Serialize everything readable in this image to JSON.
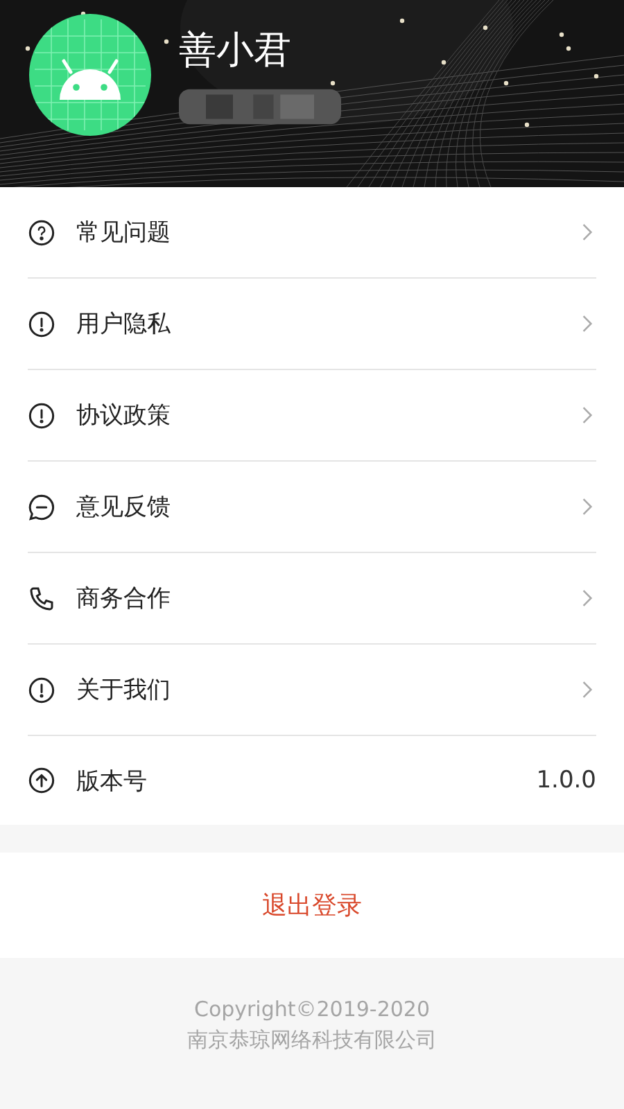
{
  "profile": {
    "name": "善小君"
  },
  "menu": [
    {
      "kind": "link",
      "label": "常见问题"
    },
    {
      "kind": "link",
      "label": "用户隐私"
    },
    {
      "kind": "link",
      "label": "协议政策"
    },
    {
      "kind": "link",
      "label": "意见反馈"
    },
    {
      "kind": "link",
      "label": "商务合作"
    },
    {
      "kind": "link",
      "label": "关于我们"
    },
    {
      "kind": "value",
      "label": "版本号",
      "value": "1.0.0"
    }
  ],
  "logout": "退出登录",
  "footer": {
    "copyright": "Copyright©2019-2020",
    "company": "南京恭琼网络科技有限公司"
  }
}
